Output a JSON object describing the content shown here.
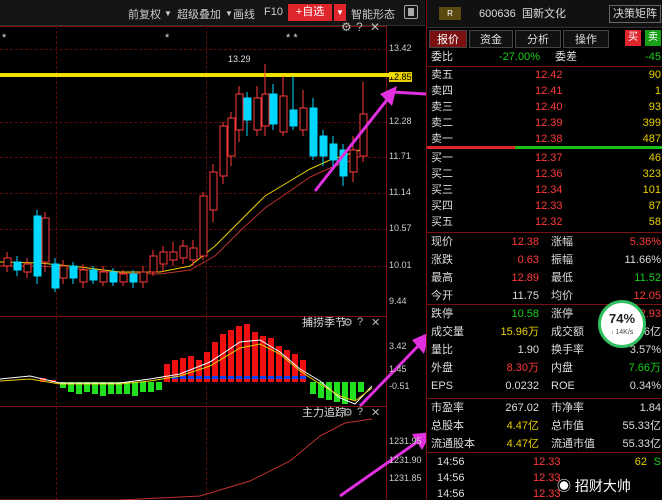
{
  "toolbar": {
    "adjust_label": "前复权",
    "overlay_label": "超级叠加",
    "draw_label": "画线",
    "f10_label": "F10",
    "add_select_label": "+自选",
    "pattern_label": "智能形态"
  },
  "main_chart": {
    "markers": [
      "*",
      "*",
      "* *"
    ],
    "high_label": "13.29",
    "y_ticks": [
      "13.42",
      "12.85",
      "12.28",
      "11.71",
      "11.14",
      "10.57",
      "10.01",
      "9.44"
    ]
  },
  "indicator1": {
    "title": "捕捞季节",
    "y_ticks": [
      "3.42",
      "1.45",
      "-0.51"
    ]
  },
  "indicator2": {
    "title": "主力追踪",
    "y_ticks": [
      "1231.95",
      "1231.90",
      "1231.85"
    ]
  },
  "right_panel": {
    "badge": "R",
    "stock_code": "600636",
    "stock_name": "国新文化",
    "matrix_button": "决策矩阵",
    "tabs": [
      "报价",
      "资金",
      "分析",
      "操作"
    ],
    "buy_button": "买",
    "sell_button": "卖",
    "commission_ratio_label": "委比",
    "commission_ratio_value": "-27.00%",
    "commission_diff_label": "委差",
    "commission_diff_value": "-45",
    "asks": [
      {
        "label": "卖五",
        "price": "12.42",
        "vol": "90"
      },
      {
        "label": "卖四",
        "price": "12.41",
        "vol": "1"
      },
      {
        "label": "卖三",
        "price": "12.40",
        "vol": "93"
      },
      {
        "label": "卖二",
        "price": "12.39",
        "vol": "399"
      },
      {
        "label": "卖一",
        "price": "12.38",
        "vol": "487"
      }
    ],
    "bids": [
      {
        "label": "买一",
        "price": "12.37",
        "vol": "46"
      },
      {
        "label": "买二",
        "price": "12.36",
        "vol": "323"
      },
      {
        "label": "买三",
        "price": "12.34",
        "vol": "101"
      },
      {
        "label": "买四",
        "price": "12.33",
        "vol": "87"
      },
      {
        "label": "买五",
        "price": "12.32",
        "vol": "58"
      }
    ],
    "stats": [
      {
        "l1": "现价",
        "v1": "12.38",
        "l2": "涨幅",
        "v2": "5.36%"
      },
      {
        "l1": "涨跌",
        "v1": "0.63",
        "l2": "振幅",
        "v2": "11.66%"
      },
      {
        "l1": "最高",
        "v1": "12.89",
        "l2": "最低",
        "v2": "11.52"
      },
      {
        "l1": "今开",
        "v1": "11.75",
        "l2": "均价",
        "v2": "12.05"
      }
    ],
    "stats2": [
      {
        "l1": "跌停",
        "v1": "10.58",
        "l2": "涨停",
        "v2": "12.93"
      },
      {
        "l1": "成交量",
        "v1": "15.96万",
        "l2": "成交额",
        "v2": "1.96亿"
      },
      {
        "l1": "量比",
        "v1": "1.90",
        "l2": "换手率",
        "v2": "3.57%"
      },
      {
        "l1": "外盘",
        "v1": "8.30万",
        "l2": "内盘",
        "v2": "7.66万"
      },
      {
        "l1": "EPS",
        "v1": "0.0232",
        "l2": "ROE",
        "v2": "0.34%"
      }
    ],
    "stats3": [
      {
        "l1": "市盈率",
        "v1": "267.02",
        "l2": "市净率",
        "v2": "1.84"
      },
      {
        "l1": "总股本",
        "v1": "4.47亿",
        "l2": "总市值",
        "v2": "55.33亿"
      },
      {
        "l1": "流通股本",
        "v1": "4.47亿",
        "l2": "流通市值",
        "v2": "55.33亿"
      }
    ],
    "ticks": [
      {
        "time": "14:56",
        "price": "12.33",
        "vol": "62",
        "side": "S"
      },
      {
        "time": "14:56",
        "price": "12.33",
        "vol": "",
        "side": ""
      },
      {
        "time": "14:56",
        "price": "12.33",
        "vol": "",
        "side": ""
      }
    ],
    "speed_percent": "74%",
    "speed_rate": "14K/s",
    "watermark": "招财大帅"
  }
}
